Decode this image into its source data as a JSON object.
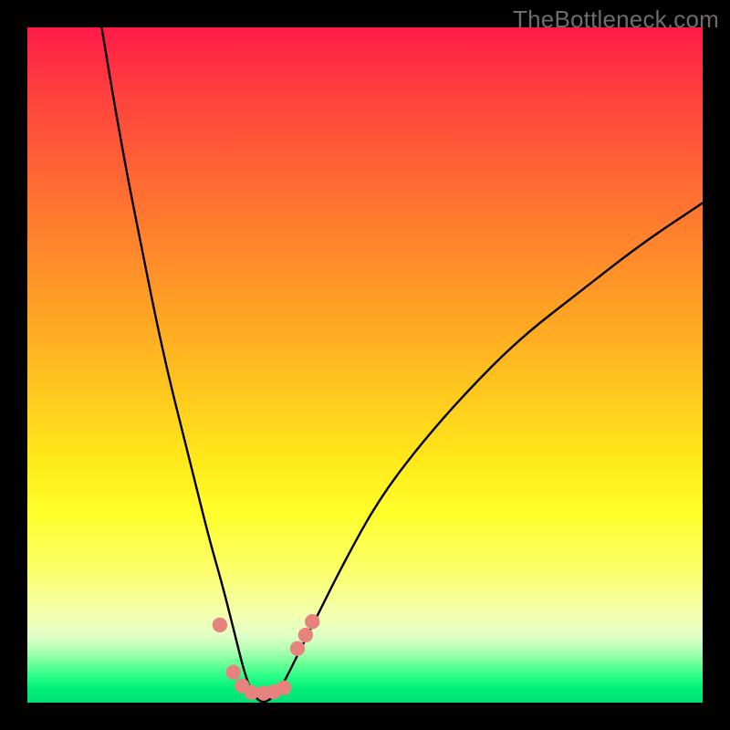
{
  "watermark": "TheBottleneck.com",
  "colors": {
    "frame_border": "#000000",
    "curve_stroke": "#000000",
    "marker_fill": "#e7827e",
    "marker_stroke": "#e7827e",
    "gradient_top": "#ff1a49",
    "gradient_bottom": "#00e072"
  },
  "chart_data": {
    "type": "line",
    "title": "",
    "xlabel": "",
    "ylabel": "",
    "xlim": [
      0,
      100
    ],
    "ylim": [
      0,
      100
    ],
    "grid": false,
    "legend": false,
    "description": "V-shaped bottleneck curve with minimum near x≈34. Left branch falls steeply from top edge (y≈100 at x≈11) to y≈0 at x≈32; right branch rises from y≈0 at x≈38 toward ~74 at x=100. Markers cluster around the bottom of the V.",
    "series": [
      {
        "name": "curve",
        "x": [
          11,
          13,
          15,
          17,
          19,
          21,
          23,
          25,
          27,
          29,
          31,
          32,
          33,
          34,
          35,
          36,
          37,
          38,
          40,
          43,
          47,
          52,
          58,
          65,
          73,
          82,
          91,
          100
        ],
        "y": [
          100,
          88,
          77,
          67,
          57,
          48,
          40,
          32,
          24,
          17,
          9,
          5,
          2,
          0.5,
          0,
          0.5,
          1.5,
          3,
          7,
          13,
          21,
          30,
          38,
          46,
          54,
          61,
          68,
          74
        ]
      }
    ],
    "markers": [
      {
        "x": 28.5,
        "y": 11.5,
        "r": 1.1
      },
      {
        "x": 30.5,
        "y": 4.5,
        "r": 1.1
      },
      {
        "x": 31.8,
        "y": 2.5,
        "r": 1.1
      },
      {
        "x": 33.2,
        "y": 1.5,
        "r": 1.1
      },
      {
        "x": 35.0,
        "y": 1.4,
        "r": 1.1
      },
      {
        "x": 36.5,
        "y": 1.6,
        "r": 1.1
      },
      {
        "x": 38.0,
        "y": 2.2,
        "r": 1.1
      },
      {
        "x": 40.0,
        "y": 8.0,
        "r": 1.1
      },
      {
        "x": 41.2,
        "y": 10.0,
        "r": 1.1
      },
      {
        "x": 42.2,
        "y": 12.0,
        "r": 1.1
      }
    ]
  }
}
